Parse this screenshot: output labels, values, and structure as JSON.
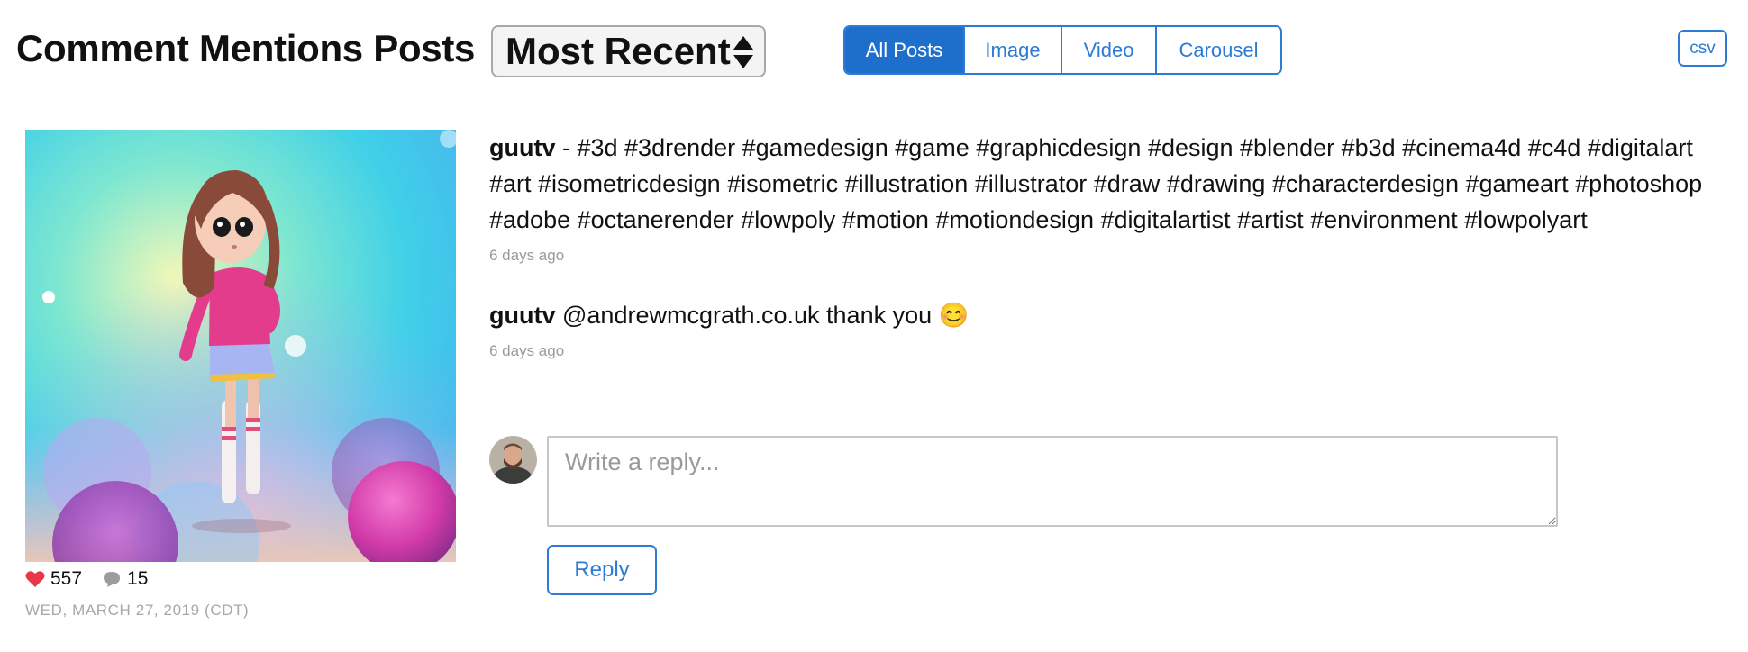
{
  "header": {
    "title": "Comment Mentions Posts",
    "sort": {
      "selected": "Most Recent"
    },
    "filters": [
      {
        "label": "All Posts",
        "active": true
      },
      {
        "label": "Image",
        "active": false
      },
      {
        "label": "Video",
        "active": false
      },
      {
        "label": "Carousel",
        "active": false
      }
    ],
    "export_label": "csv"
  },
  "post": {
    "image_icon": "3d-character-girl-image",
    "likes": "557",
    "comments_count": "15",
    "date": "WED, MARCH 27, 2019 (CDT)",
    "like_icon": "heart-icon",
    "comment_icon": "speech-bubble-icon"
  },
  "comments": [
    {
      "user": "guutv",
      "text": " - #3d #3drender #gamedesign #game #graphicdesign #design #blender #b3d #cinema4d #c4d #digitalart #art #isometricdesign #isometric #illustration #illustrator #draw #drawing #characterdesign #gameart #photoshop #adobe #octanerender #lowpoly #motion #motiondesign #digitalartist #artist #environment #lowpolyart",
      "time": "6 days ago"
    },
    {
      "user": "guutv",
      "text": " @andrewmcgrath.co.uk thank you 😊",
      "time": "6 days ago"
    }
  ],
  "reply": {
    "placeholder": "Write a reply...",
    "button_label": "Reply",
    "avatar_icon": "user-avatar"
  },
  "colors": {
    "accent": "#2d7bd4",
    "active_segment": "#1e6fcb",
    "muted_text": "#9a9a9a",
    "heart": "#e8364a"
  }
}
